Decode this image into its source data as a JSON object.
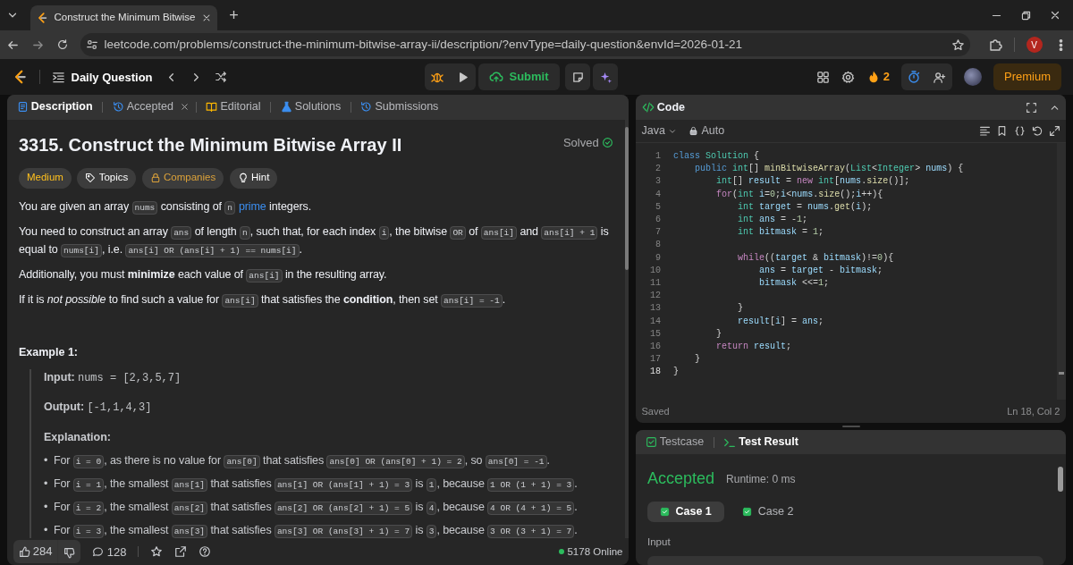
{
  "browser": {
    "tab": {
      "title": "Construct the Minimum Bitwise"
    },
    "new_tab": "+",
    "url": "leetcode.com/problems/construct-the-minimum-bitwise-array-ii/description/?envType=daily-question&envId=2026-01-21",
    "profile": "V"
  },
  "nav": {
    "title": "Daily Question",
    "submit": "Submit",
    "streak": "2",
    "premium": "Premium"
  },
  "left_tabs": [
    {
      "label": "Description",
      "kind": "description",
      "selected": true,
      "closable": false
    },
    {
      "label": "Accepted",
      "kind": "history",
      "selected": false,
      "closable": true
    },
    {
      "label": "Editorial",
      "kind": "editorial",
      "selected": false,
      "closable": false
    },
    {
      "label": "Solutions",
      "kind": "solutions",
      "selected": false,
      "closable": false
    },
    {
      "label": "Submissions",
      "kind": "history",
      "selected": false,
      "closable": false
    }
  ],
  "problem": {
    "title": "3315. Construct the Minimum Bitwise Array II",
    "status": "Solved",
    "tags": [
      {
        "label": "Medium",
        "kind": "difficulty"
      },
      {
        "label": "Topics",
        "kind": "topics"
      },
      {
        "label": "Companies",
        "kind": "companies"
      },
      {
        "label": "Hint",
        "kind": "hint"
      }
    ],
    "paragraphs": [
      [
        {
          "text": "You are given an array "
        },
        {
          "code": "nums"
        },
        {
          "text": " consisting of "
        },
        {
          "code": "n"
        },
        {
          "link": "prime"
        },
        {
          "text": " integers."
        }
      ],
      [
        {
          "text": "You need to construct an array "
        },
        {
          "code": "ans"
        },
        {
          "text": " of length "
        },
        {
          "code": "n"
        },
        {
          "text": ", such that, for each index "
        },
        {
          "code": "i"
        },
        {
          "text": ", the bitwise "
        },
        {
          "code": "OR"
        },
        {
          "text": " of "
        },
        {
          "code": "ans[i]"
        },
        {
          "text": " and "
        },
        {
          "code": "ans[i] + 1"
        },
        {
          "text": " is equal to "
        },
        {
          "code": "nums[i]"
        },
        {
          "text": ", i.e. "
        },
        {
          "code": "ans[i] OR (ans[i] + 1) == nums[i]"
        },
        {
          "text": "."
        }
      ],
      [
        {
          "text": "Additionally, you must **minimize** each value of "
        },
        {
          "code": "ans[i]"
        },
        {
          "text": " in the resulting array."
        }
      ],
      [
        {
          "text": "If it is *not possible* to find such a value for "
        },
        {
          "code": "ans[i]"
        },
        {
          "text": " that satisfies the **condition**, then set "
        },
        {
          "code": "ans[i] = -1"
        },
        {
          "text": "."
        }
      ]
    ],
    "example": {
      "title": "Example 1:",
      "input_label": "Input:",
      "input": "nums = [2,3,5,7]",
      "output_label": "Output:",
      "output": "[-1,1,4,3]",
      "explanation_label": "Explanation:",
      "bullets": [
        {
          "marker": "•",
          "segments": [
            {
              "text": "For "
            },
            {
              "code": "i = 0"
            },
            {
              "text": ", as there is no value for "
            },
            {
              "code": "ans[0]"
            },
            {
              "text": " that satisfies "
            },
            {
              "code": "ans[0] OR (ans[0] + 1) = 2"
            },
            {
              "text": ", so "
            },
            {
              "code": "ans[0] = -1"
            },
            {
              "text": "."
            }
          ]
        },
        {
          "marker": "•",
          "segments": [
            {
              "text": "For "
            },
            {
              "code": "i = 1"
            },
            {
              "text": ", the smallest "
            },
            {
              "code": "ans[1]"
            },
            {
              "text": " that satisfies "
            },
            {
              "code": "ans[1] OR (ans[1] + 1) = 3"
            },
            {
              "text": " is "
            },
            {
              "code": "1"
            },
            {
              "text": ", because "
            },
            {
              "code": "1 OR (1 + 1) = 3"
            },
            {
              "text": "."
            }
          ]
        },
        {
          "marker": "•",
          "segments": [
            {
              "text": "For "
            },
            {
              "code": "i = 2"
            },
            {
              "text": ", the smallest "
            },
            {
              "code": "ans[2]"
            },
            {
              "text": " that satisfies "
            },
            {
              "code": "ans[2] OR (ans[2] + 1) = 5"
            },
            {
              "text": " is "
            },
            {
              "code": "4"
            },
            {
              "text": ", because "
            },
            {
              "code": "4 OR (4 + 1) = 5"
            },
            {
              "text": "."
            }
          ]
        },
        {
          "marker": "•",
          "segments": [
            {
              "text": "For "
            },
            {
              "code": "i = 3"
            },
            {
              "text": ", the smallest "
            },
            {
              "code": "ans[3]"
            },
            {
              "text": " that satisfies "
            },
            {
              "code": "ans[3] OR (ans[3] + 1) = 7"
            },
            {
              "text": " is "
            },
            {
              "code": "3"
            },
            {
              "text": ", because "
            },
            {
              "code": "3 OR (3 + 1) = 7"
            },
            {
              "text": "."
            }
          ]
        }
      ]
    }
  },
  "footer": {
    "likes": "284",
    "comments": "128",
    "online": "5178 Online"
  },
  "editor": {
    "title": "Code",
    "language": "Java",
    "mode": "Auto",
    "status": "Saved",
    "cursor": "Ln 18, Col 2",
    "lines": [
      {
        "num": "1",
        "active": false,
        "tokens": [
          {
            "kw": "class "
          },
          {
            "ty": "Solution"
          },
          {
            "p": " {"
          }
        ]
      },
      {
        "num": "2",
        "active": false,
        "tokens": [
          {
            "kw": "    public "
          },
          {
            "ty": "int"
          },
          {
            "p": "[] "
          },
          {
            "fn": "minBitwiseArray"
          },
          {
            "p": "("
          },
          {
            "ty": "List"
          },
          {
            "p": "<"
          },
          {
            "ty": "Integer"
          },
          {
            "p": "> "
          },
          {
            "v": "nums"
          },
          {
            "p": ") {"
          }
        ]
      },
      {
        "num": "3",
        "active": false,
        "tokens": [
          {
            "ty": "        int"
          },
          {
            "p": "[] "
          },
          {
            "v": "result"
          },
          {
            "p": " = "
          },
          {
            "ct": "new "
          },
          {
            "ty": "int"
          },
          {
            "p": "["
          },
          {
            "v": "nums"
          },
          {
            "p": "."
          },
          {
            "fn": "size"
          },
          {
            "p": "()];"
          }
        ]
      },
      {
        "num": "4",
        "active": false,
        "tokens": [
          {
            "ct": "        for"
          },
          {
            "p": "("
          },
          {
            "ty": "int "
          },
          {
            "v": "i"
          },
          {
            "p": "="
          },
          {
            "n": "0"
          },
          {
            "p": ";"
          },
          {
            "v": "i"
          },
          {
            "p": "<"
          },
          {
            "v": "nums"
          },
          {
            "p": "."
          },
          {
            "fn": "size"
          },
          {
            "p": "();"
          },
          {
            "v": "i"
          },
          {
            "p": "++){"
          }
        ]
      },
      {
        "num": "5",
        "active": false,
        "tokens": [
          {
            "ty": "            int "
          },
          {
            "v": "target"
          },
          {
            "p": " = "
          },
          {
            "v": "nums"
          },
          {
            "p": "."
          },
          {
            "fn": "get"
          },
          {
            "p": "("
          },
          {
            "v": "i"
          },
          {
            "p": ");"
          }
        ]
      },
      {
        "num": "6",
        "active": false,
        "tokens": [
          {
            "ty": "            int "
          },
          {
            "v": "ans"
          },
          {
            "p": " = -"
          },
          {
            "n": "1"
          },
          {
            "p": ";"
          }
        ]
      },
      {
        "num": "7",
        "active": false,
        "tokens": [
          {
            "ty": "            int "
          },
          {
            "v": "bitmask"
          },
          {
            "p": " = "
          },
          {
            "n": "1"
          },
          {
            "p": ";"
          }
        ]
      },
      {
        "num": "8",
        "active": false
      },
      {
        "num": "9",
        "active": false,
        "tokens": [
          {
            "ct": "            while"
          },
          {
            "p": "(("
          },
          {
            "v": "target"
          },
          {
            "p": " & "
          },
          {
            "v": "bitmask"
          },
          {
            "p": ")!="
          },
          {
            "n": "0"
          },
          {
            "p": "){"
          }
        ]
      },
      {
        "num": "10",
        "active": false,
        "tokens": [
          {
            "v": "                ans"
          },
          {
            "p": " = "
          },
          {
            "v": "target"
          },
          {
            "p": " - "
          },
          {
            "v": "bitmask"
          },
          {
            "p": ";"
          }
        ]
      },
      {
        "num": "11",
        "active": false,
        "tokens": [
          {
            "v": "                bitmask"
          },
          {
            "p": " <<="
          },
          {
            "n": "1"
          },
          {
            "p": ";"
          }
        ]
      },
      {
        "num": "12",
        "active": false
      },
      {
        "num": "13",
        "active": false,
        "tokens": [
          {
            "p": "            }"
          }
        ]
      },
      {
        "num": "14",
        "active": false,
        "tokens": [
          {
            "v": "            result"
          },
          {
            "p": "["
          },
          {
            "v": "i"
          },
          {
            "p": "] = "
          },
          {
            "v": "ans"
          },
          {
            "p": ";"
          }
        ]
      },
      {
        "num": "15",
        "active": false,
        "tokens": [
          {
            "p": "        }"
          }
        ]
      },
      {
        "num": "16",
        "active": false,
        "tokens": [
          {
            "ct": "        return "
          },
          {
            "v": "result"
          },
          {
            "p": ";"
          }
        ]
      },
      {
        "num": "17",
        "active": false,
        "tokens": [
          {
            "p": "    }"
          }
        ]
      },
      {
        "num": "18",
        "active": true,
        "tokens": [
          {
            "p": "}"
          }
        ]
      }
    ]
  },
  "console": {
    "tabs": [
      {
        "label": "Testcase",
        "kind": "testcase",
        "selected": false
      },
      {
        "label": "Test Result",
        "kind": "result",
        "selected": true
      }
    ],
    "verdict": "Accepted",
    "runtime": "Runtime: 0 ms",
    "cases": [
      {
        "label": "Case 1",
        "selected": true,
        "passed": true
      },
      {
        "label": "Case 2",
        "selected": false,
        "passed": true
      }
    ],
    "input_label": "Input"
  }
}
